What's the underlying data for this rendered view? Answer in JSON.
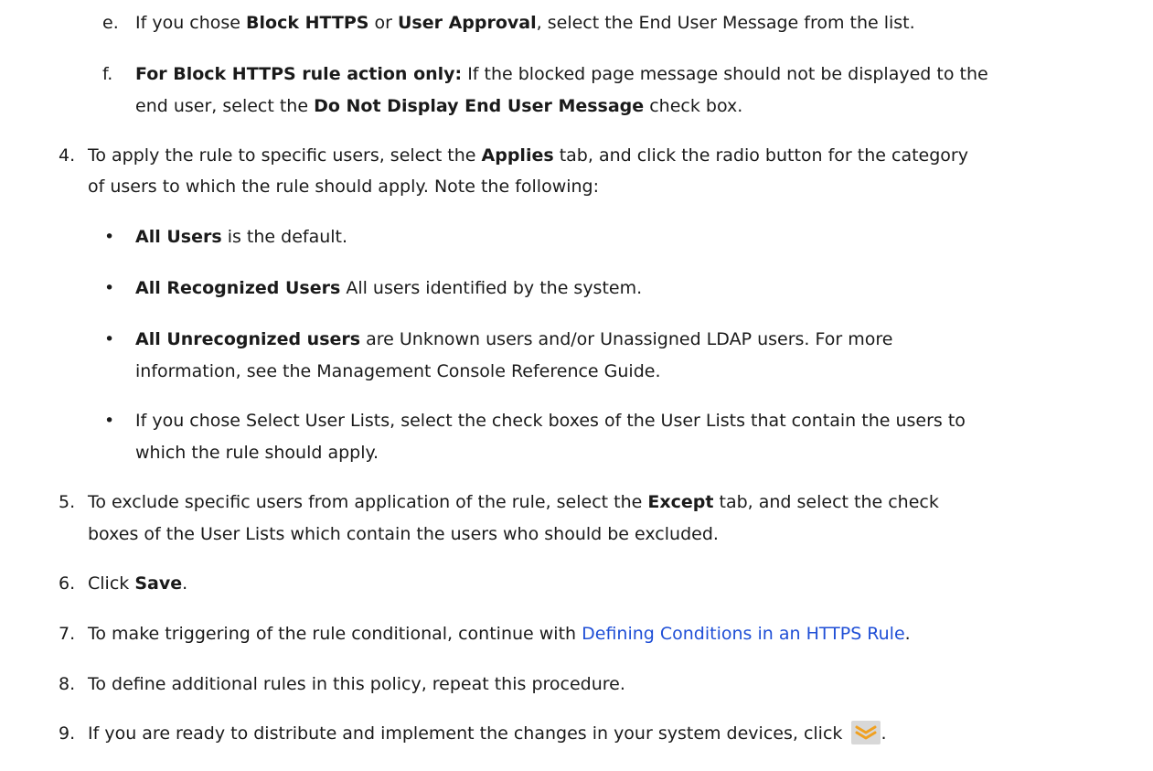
{
  "steps": {
    "e": {
      "marker": "e.",
      "t1": "If you chose ",
      "b1": "Block HTTPS",
      "t2": " or ",
      "b2": "User Approval",
      "t3": ", select the End User Message from the list."
    },
    "f": {
      "marker": "f.",
      "b1": "For Block HTTPS rule action only:",
      "t1": " If the blocked page message should not be displayed to the",
      "t2": "end user, select the ",
      "b2": "Do Not Display End User Message",
      "t3": " check box."
    },
    "s4": {
      "marker": "4.",
      "t1": "To apply the rule to specific users, select the ",
      "b1": "Applies",
      "t2": " tab, and click the radio button for the category",
      "t3": "of users to which the rule should apply. Note the following:"
    },
    "bullets": [
      {
        "marker": "•",
        "b": "All Users",
        "t": " is the default."
      },
      {
        "marker": "•",
        "b": "All Recognized Users",
        "t": " All users identified by the system."
      },
      {
        "marker": "•",
        "b": "All Unrecognized users",
        "t": " are Unknown users and/or Unassigned LDAP users. For more",
        "t2": "information, see the Management Console Reference Guide."
      },
      {
        "marker": "•",
        "t": "If you chose Select User Lists, select the check boxes of the User Lists that contain the users to",
        "t2": "which the rule should apply."
      }
    ],
    "s5": {
      "marker": "5.",
      "t1": "To exclude specific users from application of the rule, select the ",
      "b1": "Except",
      "t2": " tab, and select the check",
      "t3": "boxes of the User Lists which contain the users who should be excluded."
    },
    "s6": {
      "marker": "6.",
      "t1": "Click ",
      "b1": "Save",
      "t2": "."
    },
    "s7": {
      "marker": "7.",
      "t1": "To make triggering of the rule conditional, continue with ",
      "link": "Defining Conditions in an HTTPS Rule",
      "t2": "."
    },
    "s8": {
      "marker": "8.",
      "t1": "To define additional rules in this policy, repeat this procedure."
    },
    "s9": {
      "marker": "9.",
      "t1": "If you are ready to distribute and implement the changes in your system devices, click ",
      "icon": "distribute-changes-icon",
      "t2": "."
    }
  },
  "colors": {
    "text": "#1a1a1a",
    "link": "#1f4fd6",
    "icon_bg": "#d8d8d8",
    "icon_chevron": "#f0a020"
  }
}
